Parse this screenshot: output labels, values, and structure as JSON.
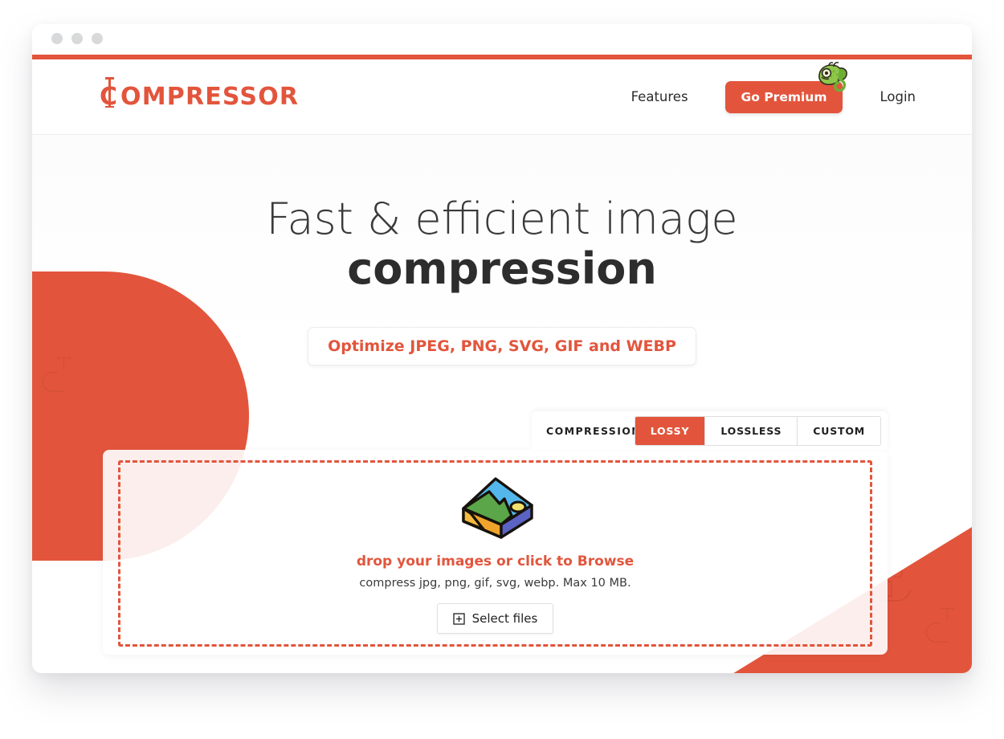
{
  "window": {
    "traffic_lights": [
      "close",
      "minimize",
      "maximize"
    ],
    "accent_color": "#e2553c"
  },
  "header": {
    "logo_text": "COMPRESSOR",
    "logo_initial": "C",
    "nav": [
      {
        "label": "Features",
        "type": "link"
      },
      {
        "label": "Go Premium",
        "type": "button",
        "mascot": "chameleon-icon"
      },
      {
        "label": "Login",
        "type": "link"
      }
    ]
  },
  "hero": {
    "title_line1": "Fast & efficient image",
    "title_line2": "compression",
    "formats_badge": "Optimize JPEG, PNG, SVG, GIF and WEBP"
  },
  "compression": {
    "label": "COMPRESSION TYPE",
    "help_glyph": "?",
    "colon": ":",
    "options": [
      {
        "label": "LOSSY",
        "active": true
      },
      {
        "label": "LOSSLESS",
        "active": false
      },
      {
        "label": "CUSTOM",
        "active": false
      }
    ]
  },
  "dropzone": {
    "icon": "image-stack-icon",
    "primary_text": "drop your images or click to Browse",
    "secondary_text": "compress jpg, png, gif, svg, webp. Max 10 MB.",
    "select_button": "Select files",
    "select_button_icon": "plus-square-icon"
  },
  "decor": {
    "pattern_icon": "c-clamp-icon",
    "shape_color": "#e2553c"
  }
}
